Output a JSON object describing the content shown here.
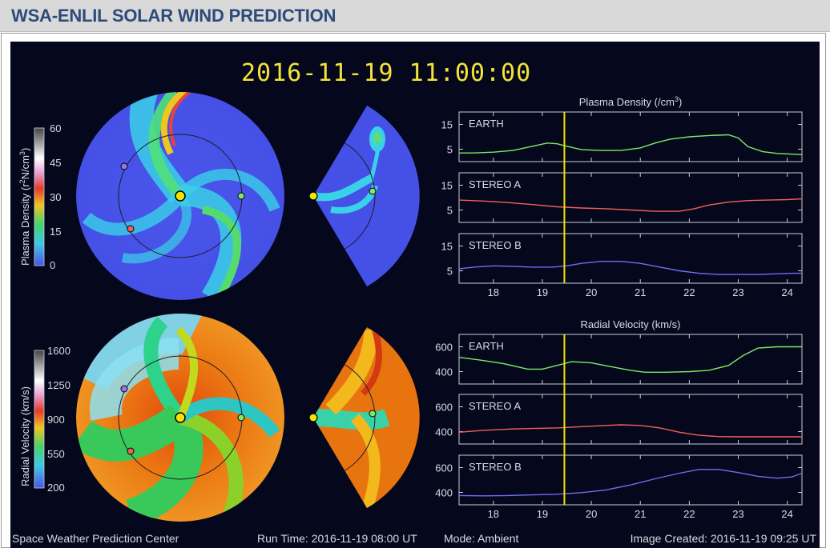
{
  "page": {
    "title": "WSA-ENLIL SOLAR WIND PREDICTION"
  },
  "timestamp": "2016-11-19   11:00:00",
  "colorbars": [
    {
      "label_html": "Plasma Density (r²N/cm³)",
      "label_plain": "Plasma Density (r",
      "label_sup1": "2",
      "label_mid": "N/cm",
      "label_sup2": "3",
      "label_end": ")",
      "ticks": [
        "60",
        "45",
        "30",
        "15",
        "0"
      ]
    },
    {
      "label": "Radial Velocity (km/s)",
      "ticks": [
        "1600",
        "1250",
        "900",
        "550",
        "200"
      ]
    }
  ],
  "chart_data": [
    {
      "type": "line",
      "title": "Plasma Density (/cm³)",
      "title_base": "Plasma Density (/cm",
      "title_sup": "3",
      "title_end": ")",
      "x_ticks": [
        "18",
        "19",
        "20",
        "21",
        "22",
        "23",
        "24"
      ],
      "xlim": [
        17.3,
        24.3
      ],
      "current_time": 19.45,
      "panels": [
        {
          "name": "EARTH",
          "color": "#7ee86a",
          "yticks": [
            "15",
            "5"
          ],
          "ylim": [
            0,
            20
          ],
          "x": [
            17.3,
            17.6,
            18.0,
            18.4,
            18.8,
            19.1,
            19.3,
            19.5,
            19.8,
            20.2,
            20.6,
            21.0,
            21.3,
            21.6,
            22.0,
            22.4,
            22.8,
            23.0,
            23.2,
            23.5,
            23.8,
            24.1,
            24.3
          ],
          "y": [
            3.5,
            3.5,
            3.8,
            4.5,
            6.2,
            7.5,
            7.2,
            6.2,
            4.8,
            4.5,
            4.5,
            5.5,
            7.5,
            9.0,
            10.0,
            10.5,
            10.8,
            9.5,
            6.0,
            4.0,
            3.3,
            3.0,
            2.8
          ]
        },
        {
          "name": "STEREO A",
          "color": "#f0605a",
          "yticks": [
            "15",
            "5"
          ],
          "ylim": [
            0,
            20
          ],
          "x": [
            17.3,
            17.8,
            18.3,
            18.8,
            19.3,
            19.8,
            20.3,
            20.8,
            21.3,
            21.8,
            22.1,
            22.4,
            22.8,
            23.2,
            23.6,
            24.0,
            24.3
          ],
          "y": [
            9.0,
            8.6,
            8.0,
            7.2,
            6.3,
            5.8,
            5.5,
            5.0,
            4.5,
            4.5,
            5.5,
            7.0,
            8.2,
            8.8,
            9.0,
            9.2,
            9.5
          ]
        },
        {
          "name": "STEREO B",
          "color": "#6b6ef0",
          "yticks": [
            "15",
            "5"
          ],
          "ylim": [
            0,
            20
          ],
          "x": [
            17.3,
            17.6,
            18.0,
            18.4,
            18.8,
            19.2,
            19.5,
            19.8,
            20.2,
            20.6,
            21.0,
            21.4,
            21.8,
            22.2,
            22.6,
            23.0,
            23.4,
            23.8,
            24.1,
            24.3
          ],
          "y": [
            5.8,
            6.5,
            7.0,
            6.8,
            6.5,
            6.5,
            7.0,
            8.0,
            8.8,
            8.8,
            8.0,
            6.5,
            5.0,
            4.0,
            3.5,
            3.5,
            3.5,
            3.8,
            4.0,
            4.0
          ]
        }
      ]
    },
    {
      "type": "line",
      "title": "Radial Velocity (km/s)",
      "x_ticks": [
        "18",
        "19",
        "20",
        "21",
        "22",
        "23",
        "24"
      ],
      "xlim": [
        17.3,
        24.3
      ],
      "current_time": 19.45,
      "panels": [
        {
          "name": "EARTH",
          "color": "#7ee86a",
          "yticks": [
            "600",
            "400"
          ],
          "ylim": [
            300,
            700
          ],
          "x": [
            17.3,
            17.7,
            18.2,
            18.7,
            19.0,
            19.3,
            19.6,
            20.0,
            20.4,
            20.8,
            21.1,
            21.5,
            22.0,
            22.4,
            22.8,
            23.1,
            23.4,
            23.8,
            24.3
          ],
          "y": [
            515,
            495,
            465,
            420,
            420,
            450,
            480,
            470,
            440,
            410,
            395,
            395,
            400,
            410,
            450,
            530,
            590,
            600,
            600
          ]
        },
        {
          "name": "STEREO A",
          "color": "#f0605a",
          "yticks": [
            "600",
            "400"
          ],
          "ylim": [
            300,
            700
          ],
          "x": [
            17.3,
            17.8,
            18.3,
            18.8,
            19.3,
            19.8,
            20.3,
            20.6,
            21.0,
            21.4,
            21.8,
            22.2,
            22.6,
            23.0,
            23.5,
            24.0,
            24.3
          ],
          "y": [
            395,
            410,
            420,
            425,
            430,
            440,
            450,
            455,
            450,
            430,
            395,
            370,
            360,
            358,
            358,
            358,
            358
          ]
        },
        {
          "name": "STEREO B",
          "color": "#6b6ef0",
          "yticks": [
            "600",
            "400"
          ],
          "ylim": [
            300,
            700
          ],
          "x": [
            17.3,
            17.8,
            18.3,
            18.8,
            19.3,
            19.8,
            20.3,
            20.8,
            21.3,
            21.8,
            22.2,
            22.6,
            23.0,
            23.4,
            23.8,
            24.1,
            24.3
          ],
          "y": [
            375,
            372,
            375,
            380,
            385,
            398,
            420,
            460,
            510,
            555,
            585,
            585,
            560,
            530,
            515,
            525,
            555
          ]
        }
      ]
    }
  ],
  "footer": {
    "center": "Space Weather Prediction Center",
    "run_time": "Run Time: 2016-11-19 08:00 UT",
    "mode": "Mode: Ambient",
    "created": "Image Created: 2016-11-19 09:25 UT"
  }
}
